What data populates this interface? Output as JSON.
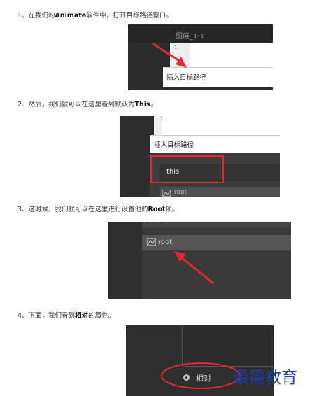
{
  "steps": [
    {
      "pre": "1、在我们的",
      "bold": "Animate",
      "post": "软件中，打开目标路径窗口。"
    },
    {
      "pre": "2、然后，我们就可以在这里看到默认为",
      "bold": "This",
      "post": "。"
    },
    {
      "pre": "3、这时候，我们就可以在这里进行设置他的",
      "bold": "Root",
      "post": "项。"
    },
    {
      "pre": "4、下面，我们看到",
      "bold": "相对",
      "post": "的属性。"
    }
  ],
  "shot1": {
    "layer_label": "图层_1:1",
    "line_number": "1",
    "popup_label": "插入目标路径"
  },
  "shot2": {
    "line_number": "1",
    "popup_label": "插入目标路径",
    "field_value": "this",
    "tree_item": "root"
  },
  "shot3": {
    "partial_text": "this",
    "tree_item": "root"
  },
  "shot4": {
    "option_label": "相对"
  },
  "watermark": "最需教育",
  "colors": {
    "highlight_red": "#e8262d",
    "dark_panel": "#2b2b2b",
    "watermark_blue": "#1d3fa8"
  }
}
